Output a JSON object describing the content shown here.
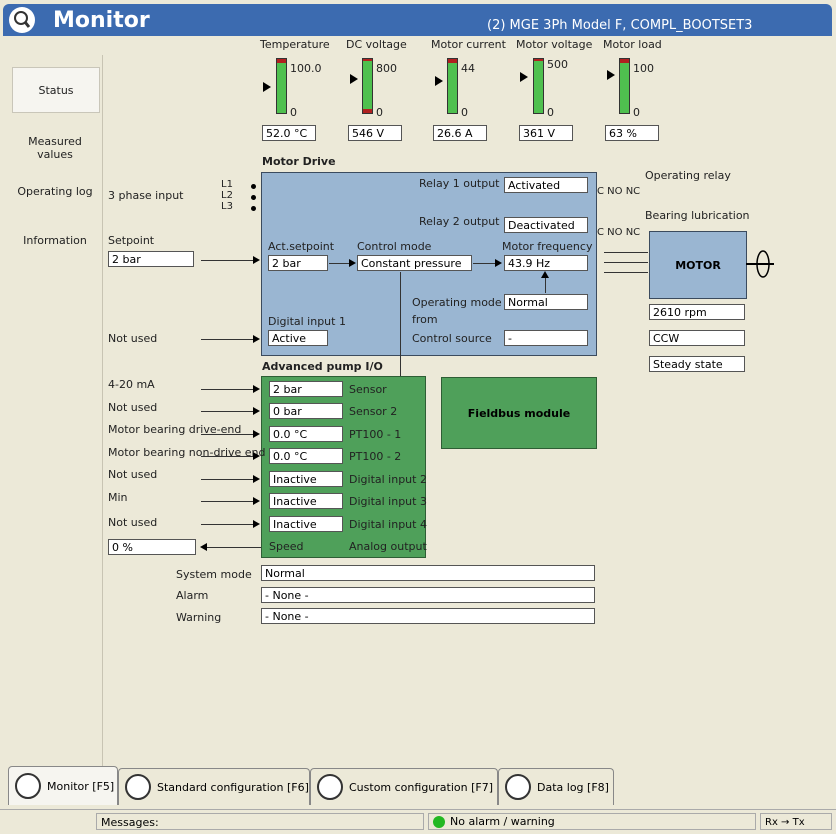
{
  "window": {
    "title": "Monitor",
    "device": "(2) MGE 3Ph Model F, COMPL_BOOTSET3"
  },
  "nav": {
    "items": [
      "Status",
      "Measured values",
      "Operating log",
      "Information"
    ]
  },
  "gauges": [
    {
      "label": "Temperature",
      "max": "100.0",
      "min": "0",
      "reading": "52.0 °C"
    },
    {
      "label": "DC voltage",
      "max": "800",
      "min": "0",
      "reading": "546 V"
    },
    {
      "label": "Motor current",
      "max": "44",
      "min": "0",
      "reading": "26.6 A"
    },
    {
      "label": "Motor voltage",
      "max": "500",
      "min": "0",
      "reading": "361 V"
    },
    {
      "label": "Motor load",
      "max": "100",
      "min": "0",
      "reading": "63 %"
    }
  ],
  "motor_drive": {
    "title": "Motor Drive",
    "three_phase": "3 phase input",
    "phases": [
      "L1",
      "L2",
      "L3"
    ],
    "relay1_label": "Relay 1 output",
    "relay1_value": "Activated",
    "relay2_label": "Relay 2 output",
    "relay2_value": "Deactivated",
    "setpoint_label": "Setpoint",
    "setpoint_value": "2 bar",
    "act_setpoint_label": "Act.setpoint",
    "act_setpoint_value": "2 bar",
    "control_mode_label": "Control mode",
    "control_mode_value": "Constant pressure",
    "motor_freq_label": "Motor frequency",
    "motor_freq_value": "43.9 Hz",
    "op_mode_label": "Operating mode",
    "op_mode_value": "Normal",
    "from_label": "from",
    "control_source_label": "Control source",
    "control_source_value": "-",
    "digital_input1_label": "Digital input 1",
    "digital_input1_value": "Active",
    "not_used_label": "Not used"
  },
  "relays": {
    "operating": "Operating relay",
    "bearing": "Bearing lubrication",
    "contacts": "C NO NC"
  },
  "motor": {
    "label": "MOTOR",
    "rpm": "2610 rpm",
    "direction": "CCW",
    "state": "Steady state"
  },
  "advanced_io": {
    "title": "Advanced pump I/O",
    "rows": [
      {
        "input": "4-20 mA",
        "value": "2 bar",
        "name": "Sensor"
      },
      {
        "input": "Not used",
        "value": "0 bar",
        "name": "Sensor 2"
      },
      {
        "input": "Motor bearing drive-end",
        "value": "0.0 °C",
        "name": "PT100 - 1"
      },
      {
        "input": "Motor bearing non-drive end",
        "value": "0.0 °C",
        "name": "PT100 - 2"
      },
      {
        "input": "Not used",
        "value": "Inactive",
        "name": "Digital input 2"
      },
      {
        "input": "Min",
        "value": "Inactive",
        "name": "Digital input 3"
      },
      {
        "input": "Not used",
        "value": "Inactive",
        "name": "Digital input 4"
      }
    ],
    "speed_label": "Speed",
    "analog_output_label": "Analog output",
    "analog_output_value": "0 %"
  },
  "fieldbus": {
    "label": "Fieldbus module"
  },
  "system": {
    "mode_label": "System mode",
    "mode_value": "Normal",
    "alarm_label": "Alarm",
    "alarm_value": "- None -",
    "warning_label": "Warning",
    "warning_value": "- None -"
  },
  "tabs": [
    "Monitor [F5]",
    "Standard configuration [F6]",
    "Custom configuration [F7]",
    "Data log [F8]"
  ],
  "statusbar": {
    "messages": "Messages:",
    "alarm_status": "No alarm / warning",
    "rx": "Rx",
    "tx": "Tx",
    "status_ok_color": "#22b822"
  }
}
